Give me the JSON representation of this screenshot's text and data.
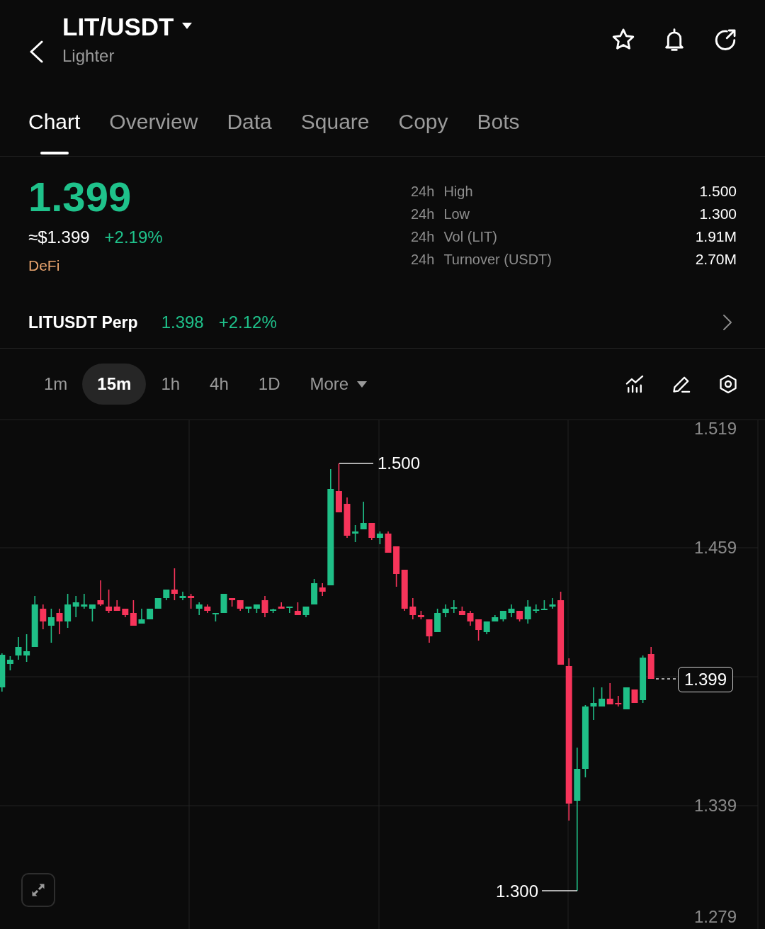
{
  "header": {
    "title": "LIT/USDT",
    "subtitle": "Lighter"
  },
  "tabs": [
    {
      "label": "Chart",
      "selected": true
    },
    {
      "label": "Overview",
      "selected": false
    },
    {
      "label": "Data",
      "selected": false
    },
    {
      "label": "Square",
      "selected": false
    },
    {
      "label": "Copy",
      "selected": false
    },
    {
      "label": "Bots",
      "selected": false
    }
  ],
  "ticker": {
    "price": "1.399",
    "usd_price": "≈$1.399",
    "change": "+2.19%",
    "rising": true,
    "category": "DeFi"
  },
  "stats": [
    {
      "period": "24h",
      "label": "High",
      "value": "1.500"
    },
    {
      "period": "24h",
      "label": "Low",
      "value": "1.300"
    },
    {
      "period": "24h",
      "label": "Vol (LIT)",
      "value": "1.91M"
    },
    {
      "period": "24h",
      "label": "Turnover (USDT)",
      "value": "2.70M"
    }
  ],
  "perpetual": {
    "name": "LITUSDT Perp",
    "price": "1.398",
    "change": "+2.12%",
    "rising": true
  },
  "intervals": [
    {
      "label": "1m",
      "selected": false
    },
    {
      "label": "15m",
      "selected": true
    },
    {
      "label": "1h",
      "selected": false
    },
    {
      "label": "4h",
      "selected": false
    },
    {
      "label": "1D",
      "selected": false
    }
  ],
  "more_menu": {
    "label": "More"
  },
  "chart": {
    "y_axis_labels": [
      "1.519",
      "1.459",
      "1.339",
      "1.279"
    ],
    "high_label": "1.500",
    "low_label": "1.300",
    "last_price": "1.399"
  }
}
